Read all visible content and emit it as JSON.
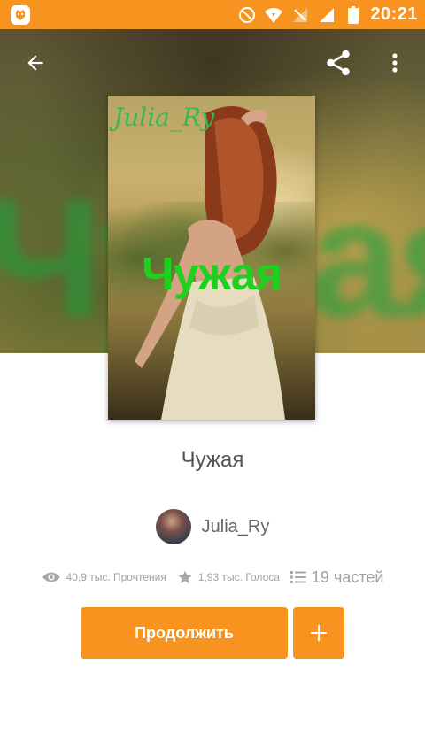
{
  "status_bar": {
    "time": "20:21",
    "icons": [
      "app-badge-icon",
      "do-not-disturb-icon",
      "wifi-icon",
      "no-signal-icon",
      "signal-icon",
      "battery-icon"
    ],
    "background": "#f7931e"
  },
  "toolbar": {
    "back_icon": "arrow-left-icon",
    "share_icon": "share-icon",
    "more_icon": "more-vert-icon"
  },
  "cover": {
    "author_script": "Julia_Ry",
    "title": "Чужая",
    "title_color": "#1fd11f"
  },
  "hero": {
    "blurred_title": "Чужая"
  },
  "story": {
    "title": "Чужая",
    "author": "Julia_Ry"
  },
  "stats": {
    "reads": "40,9 тыс. Прочтения",
    "votes": "1,93 тыс. Голоса",
    "parts": "19 частей"
  },
  "actions": {
    "continue_label": "Продолжить",
    "add_label": "+",
    "accent": "#f7931e"
  }
}
